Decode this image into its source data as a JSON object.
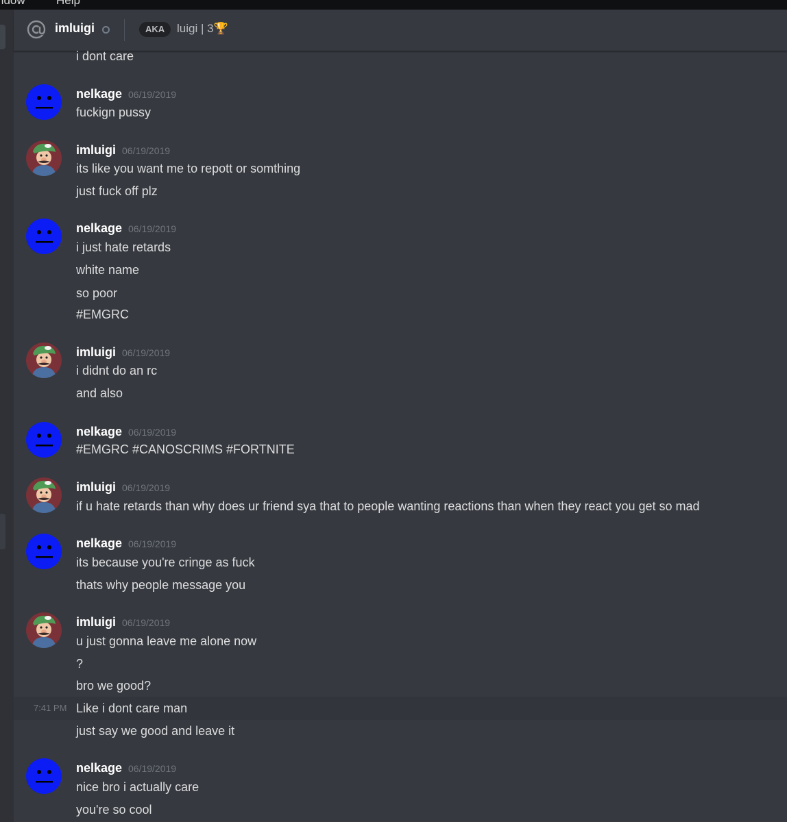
{
  "menubar": {
    "items": [
      "ndow",
      "Help"
    ]
  },
  "header": {
    "username": "imluigi",
    "aka_label": "AKA",
    "aka_name": "luigi | 3🏆",
    "icons": {
      "at": "at-icon",
      "status": "offline-status-icon"
    }
  },
  "chat": {
    "colors": {
      "nelkage_avatar": "#0c1cf5",
      "background": "#36393f"
    },
    "top_line": "i dont care",
    "groups": [
      {
        "author": "nelkage",
        "timestamp": "06/19/2019",
        "avatar": "blue-face-avatar",
        "lines": [
          "fuckign pussy"
        ]
      },
      {
        "author": "imluigi",
        "timestamp": "06/19/2019",
        "avatar": "luigi-avatar",
        "lines": [
          "its like you want me to repott or somthing",
          "just fuck off plz"
        ]
      },
      {
        "author": "nelkage",
        "timestamp": "06/19/2019",
        "avatar": "blue-face-avatar",
        "lines": [
          "i just hate retards",
          "white name",
          "so poor",
          "#EMGRC"
        ]
      },
      {
        "author": "imluigi",
        "timestamp": "06/19/2019",
        "avatar": "luigi-avatar",
        "lines": [
          "i didnt do an rc",
          "and also"
        ]
      },
      {
        "author": "nelkage",
        "timestamp": "06/19/2019",
        "avatar": "blue-face-avatar",
        "lines": [
          "#EMGRC #CANOSCRIMS #FORTNITE"
        ]
      },
      {
        "author": "imluigi",
        "timestamp": "06/19/2019",
        "avatar": "luigi-avatar",
        "lines": [
          "if u hate retards than why does ur friend sya that to people wanting reactions than when they react you get so mad"
        ]
      },
      {
        "author": "nelkage",
        "timestamp": "06/19/2019",
        "avatar": "blue-face-avatar",
        "lines": [
          "its because you're cringe as fuck",
          "thats why people message you"
        ]
      },
      {
        "author": "imluigi",
        "timestamp": "06/19/2019",
        "avatar": "luigi-avatar",
        "lines": [
          "u just gonna leave me alone now",
          "?",
          "bro we good?",
          "Like i dont care man",
          "just say we good and leave it"
        ]
      },
      {
        "author": "nelkage",
        "timestamp": "06/19/2019",
        "avatar": "blue-face-avatar",
        "lines": [
          "nice bro i actually care",
          "you're so cool"
        ]
      }
    ],
    "hover_time": "7:41 PM"
  }
}
